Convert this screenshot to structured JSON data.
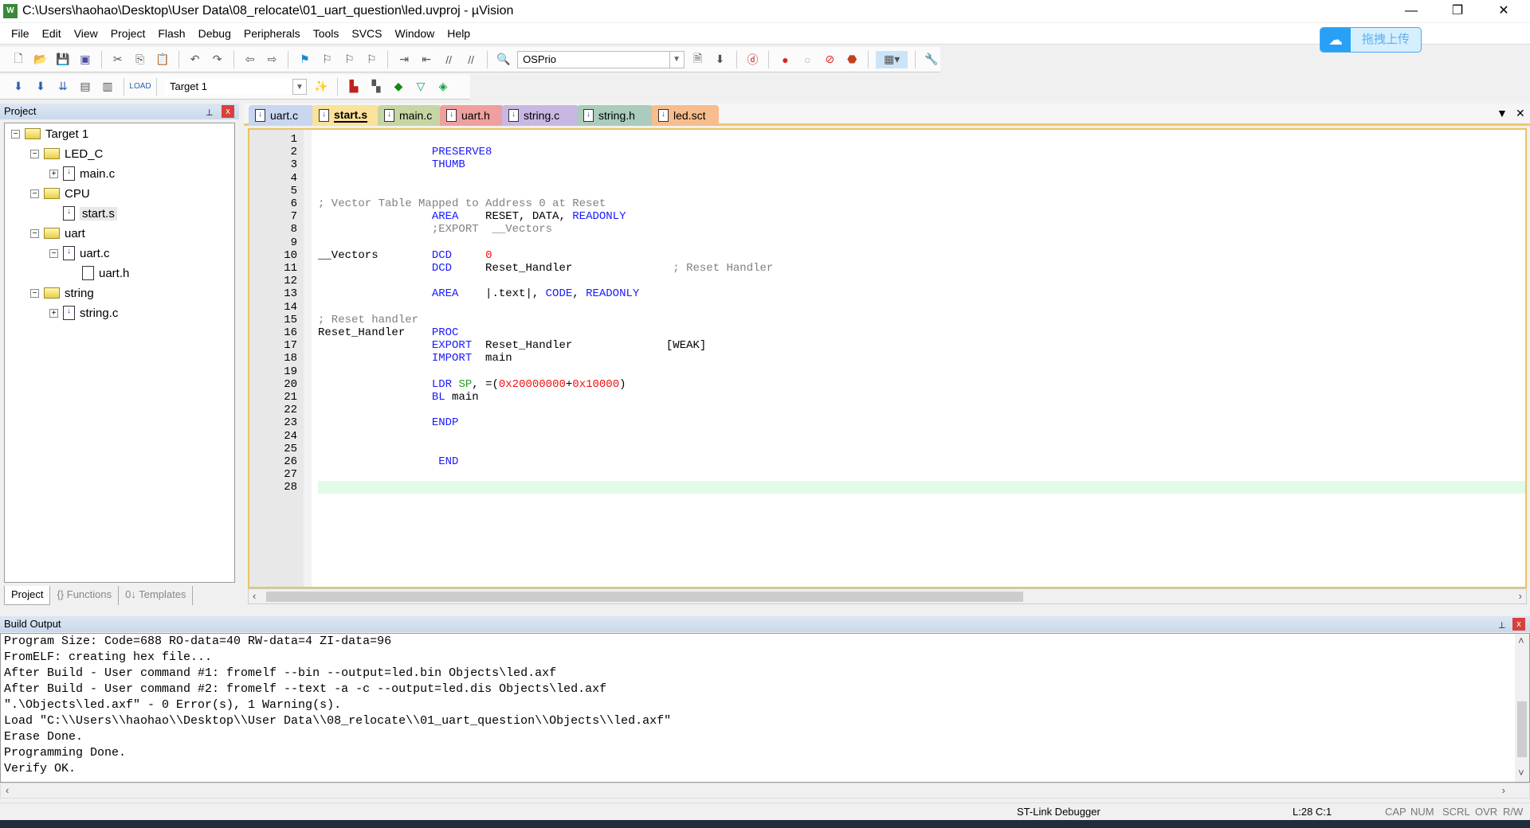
{
  "window": {
    "title": "C:\\Users\\haohao\\Desktop\\User Data\\08_relocate\\01_uart_question\\led.uvproj - µVision",
    "logo": "W",
    "minimize": "—",
    "restore": "❐",
    "close": "✕"
  },
  "menu": [
    "File",
    "Edit",
    "View",
    "Project",
    "Flash",
    "Debug",
    "Peripherals",
    "Tools",
    "SVCS",
    "Window",
    "Help"
  ],
  "toolbar1": {
    "combo_value": "OSPrio"
  },
  "toolbar2": {
    "target_value": "Target 1"
  },
  "upload": {
    "label": "拖拽上传",
    "icon": "cloud-icon"
  },
  "project_panel": {
    "title": "Project",
    "pin": "⊥",
    "close": "x",
    "tree": [
      {
        "label": "Target 1",
        "type": "target",
        "expander": "−"
      },
      {
        "label": "LED_C",
        "type": "folder",
        "expander": "−"
      },
      {
        "label": "main.c",
        "type": "file",
        "expander": "+"
      },
      {
        "label": "CPU",
        "type": "folder",
        "expander": "−"
      },
      {
        "label": "start.s",
        "type": "file",
        "expander": ""
      },
      {
        "label": "uart",
        "type": "folder",
        "expander": "−"
      },
      {
        "label": "uart.c",
        "type": "file",
        "expander": "−"
      },
      {
        "label": "uart.h",
        "type": "header",
        "expander": ""
      },
      {
        "label": "string",
        "type": "folder",
        "expander": "−"
      },
      {
        "label": "string.c",
        "type": "file",
        "expander": "+"
      }
    ],
    "tabs": [
      "Project",
      "{} Functions",
      "0↓ Templates"
    ]
  },
  "editor": {
    "tabs": [
      {
        "label": "uart.c",
        "color": "#c9d6f0"
      },
      {
        "label": "start.s",
        "color": "#fbe29a",
        "active": true
      },
      {
        "label": "main.c",
        "color": "#c6d5a4"
      },
      {
        "label": "uart.h",
        "color": "#ef9f9f"
      },
      {
        "label": "string.c",
        "color": "#c9b7e3"
      },
      {
        "label": "string.h",
        "color": "#a9ccbc"
      },
      {
        "label": "led.sct",
        "color": "#f7bd8c"
      }
    ],
    "tab_menu": "▼",
    "tab_close": "✕",
    "current_line": 28,
    "lines": [
      [],
      [
        [
          "                 ",
          ""
        ],
        [
          "PRESERVE8",
          "kw"
        ]
      ],
      [
        [
          "                 ",
          ""
        ],
        [
          "THUMB",
          "kw"
        ]
      ],
      [],
      [],
      [
        [
          "; Vector Table Mapped to Address 0 at Reset",
          "cm"
        ]
      ],
      [
        [
          "                 ",
          ""
        ],
        [
          "AREA",
          "kw"
        ],
        [
          "    RESET, DATA, ",
          ""
        ],
        [
          "READONLY",
          "kw"
        ]
      ],
      [
        [
          "                 ",
          ""
        ],
        [
          ";EXPORT  __Vectors",
          "cm"
        ]
      ],
      [],
      [
        [
          "__Vectors        ",
          ""
        ],
        [
          "DCD",
          "kw"
        ],
        [
          "     ",
          ""
        ],
        [
          "0",
          "num"
        ]
      ],
      [
        [
          "                 ",
          ""
        ],
        [
          "DCD",
          "kw"
        ],
        [
          "     Reset_Handler               ",
          ""
        ],
        [
          "; Reset Handler",
          "cm"
        ]
      ],
      [],
      [
        [
          "                 ",
          ""
        ],
        [
          "AREA",
          "kw"
        ],
        [
          "    |.text|, ",
          ""
        ],
        [
          "CODE",
          "kw"
        ],
        [
          ", ",
          ""
        ],
        [
          "READONLY",
          "kw"
        ]
      ],
      [],
      [
        [
          "; Reset handler",
          "cm"
        ]
      ],
      [
        [
          "Reset_Handler    ",
          ""
        ],
        [
          "PROC",
          "kw"
        ]
      ],
      [
        [
          "                 ",
          ""
        ],
        [
          "EXPORT",
          "kw"
        ],
        [
          "  Reset_Handler              [WEAK]",
          ""
        ]
      ],
      [
        [
          "                 ",
          ""
        ],
        [
          "IMPORT",
          "kw"
        ],
        [
          "  main",
          ""
        ]
      ],
      [],
      [
        [
          "                 ",
          ""
        ],
        [
          "LDR",
          "kw"
        ],
        [
          " ",
          ""
        ],
        [
          "SP",
          "reg"
        ],
        [
          ", =(",
          ""
        ],
        [
          "0x20000000",
          "num"
        ],
        [
          "+",
          ""
        ],
        [
          "0x10000",
          "num"
        ],
        [
          ")",
          ""
        ]
      ],
      [
        [
          "                 ",
          ""
        ],
        [
          "BL",
          "kw"
        ],
        [
          " main",
          ""
        ]
      ],
      [],
      [
        [
          "                 ",
          ""
        ],
        [
          "ENDP",
          "kw"
        ]
      ],
      [],
      [],
      [
        [
          "                  ",
          ""
        ],
        [
          "END",
          "kw"
        ]
      ],
      [],
      []
    ]
  },
  "build_output": {
    "title": "Build Output",
    "lines": [
      "Program Size: Code=688 RO-data=40 RW-data=4 ZI-data=96",
      "FromELF: creating hex file...",
      "After Build - User command #1: fromelf --bin --output=led.bin Objects\\led.axf",
      "After Build - User command #2: fromelf --text -a -c --output=led.dis Objects\\led.axf",
      "\".\\Objects\\led.axf\" - 0 Error(s), 1 Warning(s).",
      "Load \"C:\\\\Users\\\\haohao\\\\Desktop\\\\User Data\\\\08_relocate\\\\01_uart_question\\\\Objects\\\\led.axf\"",
      "Erase Done.",
      "Programming Done.",
      "Verify OK."
    ]
  },
  "status": {
    "debugger": "ST-Link Debugger",
    "position": "L:28 C:1",
    "cap": "CAP",
    "num": "NUM",
    "scrl": "SCRL",
    "ovr": "OVR",
    "rw": "R/W"
  }
}
